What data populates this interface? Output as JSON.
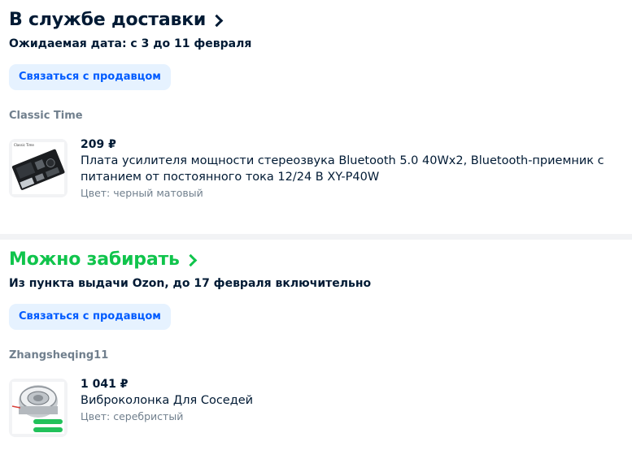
{
  "orders": [
    {
      "status": "В службе доставки",
      "status_color": "#001a34",
      "subtitle": "Ожидаемая дата: с 3 до 11 февраля",
      "contact_label": "Связаться с продавцом",
      "seller": "Classic Time",
      "product": {
        "price": "209 ₽",
        "name": "Плата усилителя мощности стереозвука Bluetooth 5.0 40Wx2, Bluetooth-приемник с питанием от постоянного тока 12/24 В XY-P40W",
        "color": "Цвет: черный матовый",
        "thumb_caption": "Classic Time"
      }
    },
    {
      "status": "Можно забирать",
      "status_color": "#10c44c",
      "subtitle": "Из пункта выдачи Ozon, до 17 февраля включительно",
      "contact_label": "Связаться с продавцом",
      "seller": "Zhangsheqing11",
      "product": {
        "price": "1 041 ₽",
        "name": "Виброколонка Для Соседей",
        "color": "Цвет: серебристый"
      }
    }
  ],
  "icons": {
    "status_chevron": "chevron-right-icon"
  }
}
